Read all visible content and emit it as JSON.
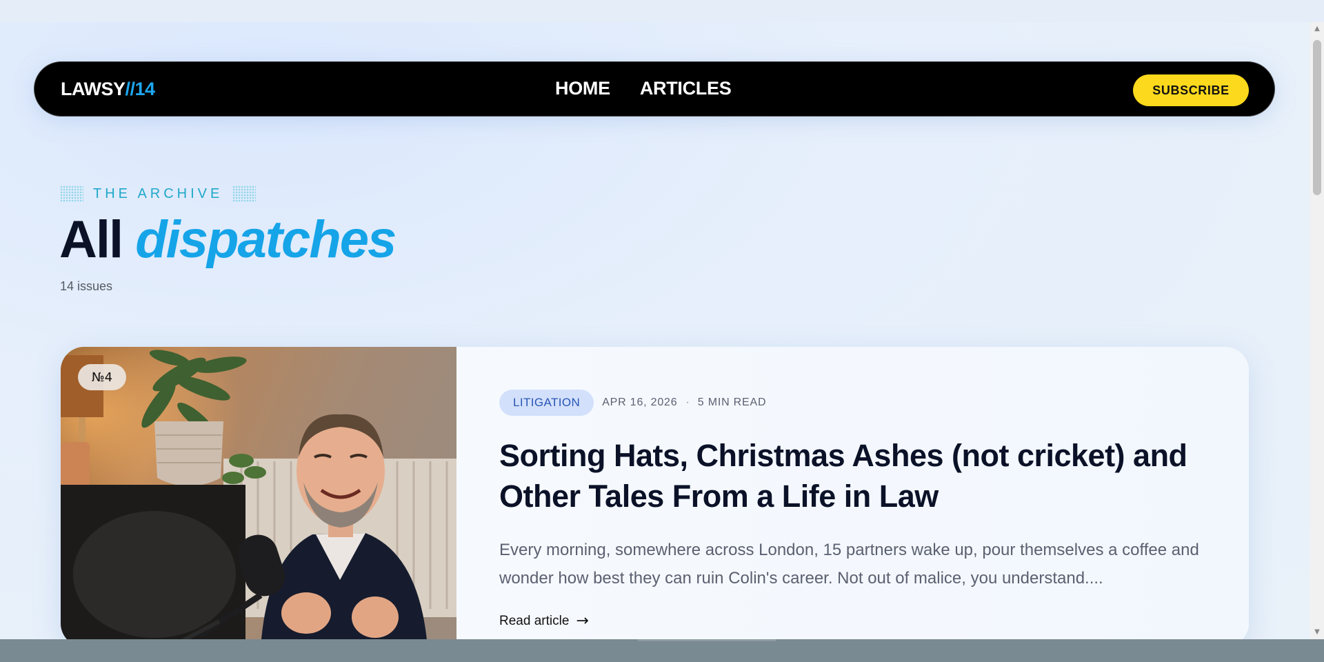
{
  "nav": {
    "logo_main": "LAWSY",
    "logo_accent": "//14",
    "links": [
      "HOME",
      "ARTICLES"
    ],
    "subscribe_label": "SUBSCRIBE"
  },
  "archive": {
    "eyebrow": "THE ARCHIVE",
    "title_plain": "All",
    "title_accent": "dispatches",
    "count": "14 issues"
  },
  "featured": {
    "issue": "№4",
    "tag": "LITIGATION",
    "date": "APR 16, 2026",
    "separator": "·",
    "read_time": "5 MIN READ",
    "title": "Sorting Hats, Christmas Ashes (not cricket) and Other Tales From a Life in Law",
    "excerpt": "Every morning, somewhere across London, 15 partners wake up, pour themselves a coffee and wonder how best they can ruin Colin's career. Not out of malice, you understand....",
    "read_label": "Read article",
    "read_arrow": "→"
  },
  "colors": {
    "accent_blue": "#15a4e8",
    "subscribe_yellow": "#fcd91c",
    "nav_bg": "#000000",
    "tag_bg": "#d3e0fb",
    "tag_text": "#2856b5"
  }
}
